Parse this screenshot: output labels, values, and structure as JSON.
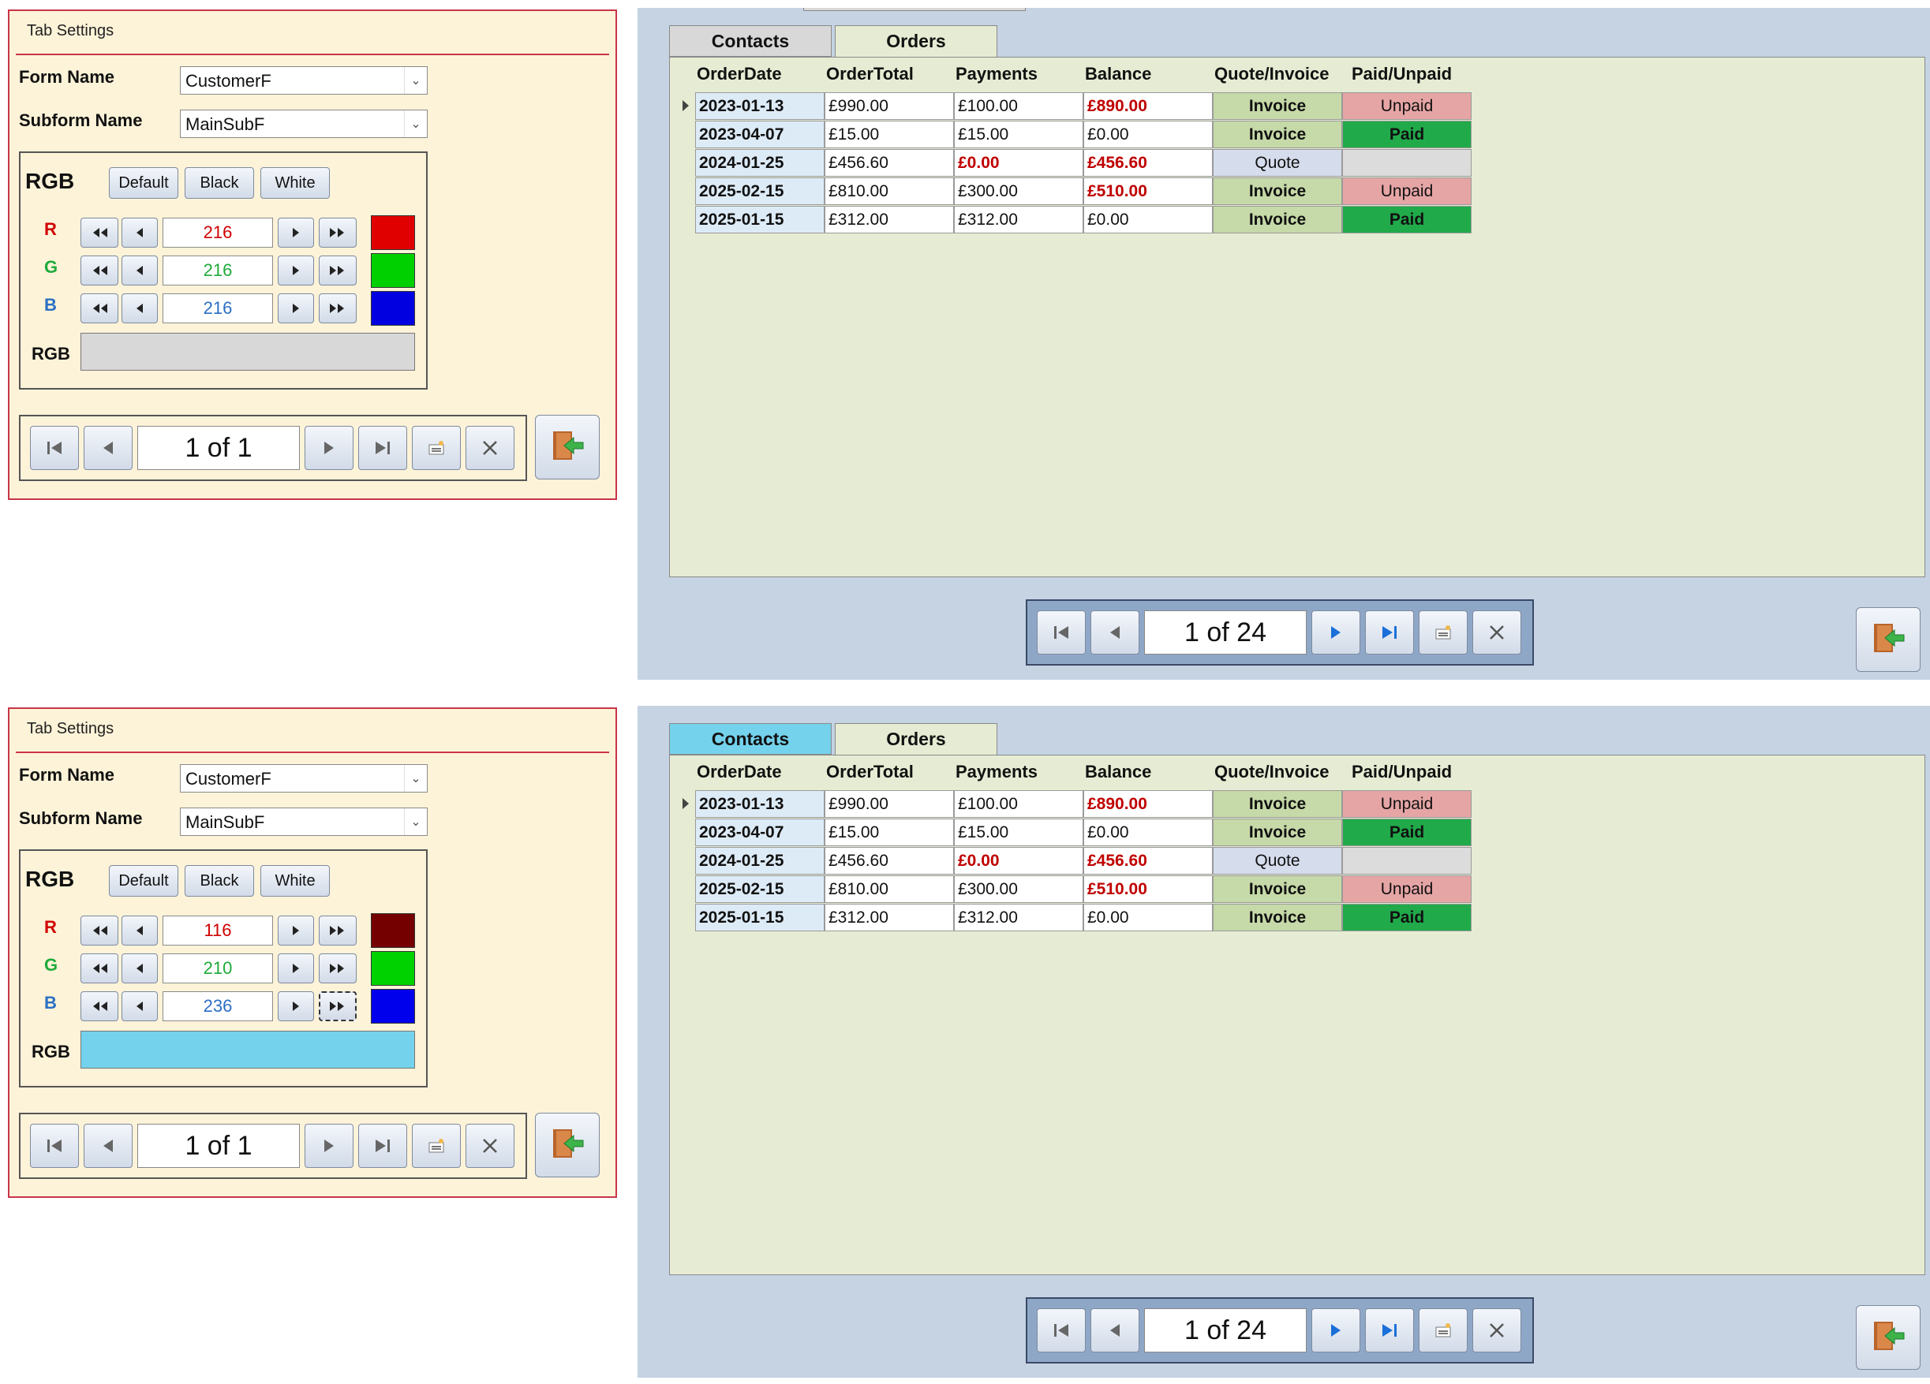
{
  "screens": [
    {
      "settings": {
        "title": "Tab Settings",
        "form_name_label": "Form Name",
        "form_name_value": "CustomerF",
        "subform_name_label": "Subform Name",
        "subform_name_value": "MainSubF",
        "rgb_heading": "RGB",
        "preset_default": "Default",
        "preset_black": "Black",
        "preset_white": "White",
        "r_label": "R",
        "g_label": "G",
        "b_label": "B",
        "r_value": "216",
        "g_value": "216",
        "b_value": "216",
        "r_swatch": "#e00000",
        "g_swatch": "#00d000",
        "b_swatch": "#0000e0",
        "rgb_result_label": "RGB",
        "rgb_result_color": "#d8d8d8",
        "record_counter": "1 of 1"
      },
      "form": {
        "tab_contacts": "Contacts",
        "tab_orders": "Orders",
        "tab_contacts_color": "#d8d8d8",
        "record_counter": "1 of 24"
      }
    },
    {
      "settings": {
        "title": "Tab Settings",
        "form_name_label": "Form Name",
        "form_name_value": "CustomerF",
        "subform_name_label": "Subform Name",
        "subform_name_value": "MainSubF",
        "rgb_heading": "RGB",
        "preset_default": "Default",
        "preset_black": "Black",
        "preset_white": "White",
        "r_label": "R",
        "g_label": "G",
        "b_label": "B",
        "r_value": "116",
        "g_value": "210",
        "b_value": "236",
        "r_swatch": "#740000",
        "g_swatch": "#00d200",
        "b_swatch": "#0000ec",
        "rgb_result_label": "RGB",
        "rgb_result_color": "#74d2ec",
        "record_counter": "1 of 1"
      },
      "form": {
        "tab_contacts": "Contacts",
        "tab_orders": "Orders",
        "tab_contacts_color": "#74d2ec",
        "record_counter": "1 of 24"
      }
    }
  ],
  "orders": {
    "headers": [
      "OrderDate",
      "OrderTotal",
      "Payments",
      "Balance",
      "Quote/Invoice",
      "Paid/Unpaid"
    ],
    "rows": [
      {
        "date": "2023-01-13",
        "total": "£990.00",
        "payments": "£100.00",
        "balance": "£890.00",
        "type": "Invoice",
        "status": "Unpaid"
      },
      {
        "date": "2023-04-07",
        "total": "£15.00",
        "payments": "£15.00",
        "balance": "£0.00",
        "type": "Invoice",
        "status": "Paid"
      },
      {
        "date": "2024-01-25",
        "total": "£456.60",
        "payments": "£0.00",
        "balance": "£456.60",
        "type": "Quote",
        "status": ""
      },
      {
        "date": "2025-02-15",
        "total": "£810.00",
        "payments": "£300.00",
        "balance": "£510.00",
        "type": "Invoice",
        "status": "Unpaid"
      },
      {
        "date": "2025-01-15",
        "total": "£312.00",
        "payments": "£312.00",
        "balance": "£0.00",
        "type": "Invoice",
        "status": "Paid"
      }
    ]
  },
  "colors": {
    "panel_border": "#c8354a",
    "panel_bg": "#fdf3d8",
    "form_bg": "#c5d3e3",
    "subform_bg": "#e5ecd3",
    "paid": "#21aa4a",
    "unpaid": "#e6a5a5",
    "invoice": "#c6d9a8",
    "negative_text": "#c00000"
  }
}
